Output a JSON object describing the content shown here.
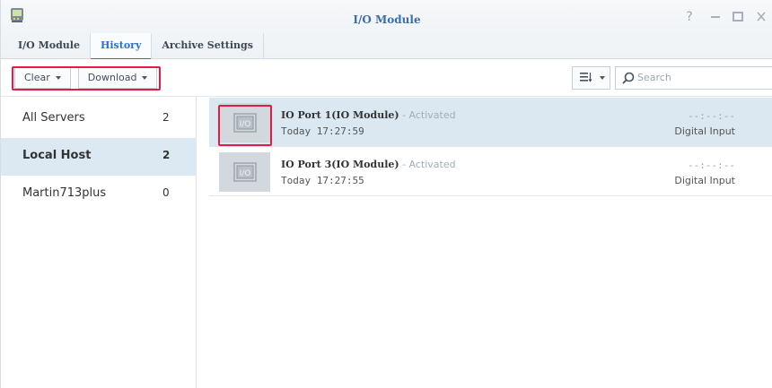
{
  "window": {
    "title": "I/O Module",
    "controls": [
      "help-icon",
      "minimize-icon",
      "maximize-icon",
      "close-icon"
    ]
  },
  "tabs": [
    {
      "label": "I/O Module",
      "active": false
    },
    {
      "label": "History",
      "active": true
    },
    {
      "label": "Archive Settings",
      "active": false
    }
  ],
  "toolbar": {
    "clear_label": "Clear",
    "download_label": "Download",
    "sort_icon": "sort-icon",
    "search_placeholder": "Search"
  },
  "sidebar": {
    "items": [
      {
        "label": "All Servers",
        "count": "2",
        "selected": false
      },
      {
        "label": "Local Host",
        "count": "2",
        "selected": true
      },
      {
        "label": "Martin713plus",
        "count": "0",
        "selected": false
      }
    ]
  },
  "events": [
    {
      "name": "IO Port 1(IO Module)",
      "status": " - Activated",
      "time": "Today 17:27:59",
      "value": "--:--:--",
      "type": "Digital Input",
      "selected": true
    },
    {
      "name": "IO Port 3(IO Module)",
      "status": " - Activated",
      "time": "Today 17:27:55",
      "value": "--:--:--",
      "type": "Digital Input",
      "selected": false
    }
  ],
  "colors": {
    "accent": "#2c72c7",
    "highlight": "#e21c45",
    "selected_row": "#dbe8f1"
  }
}
